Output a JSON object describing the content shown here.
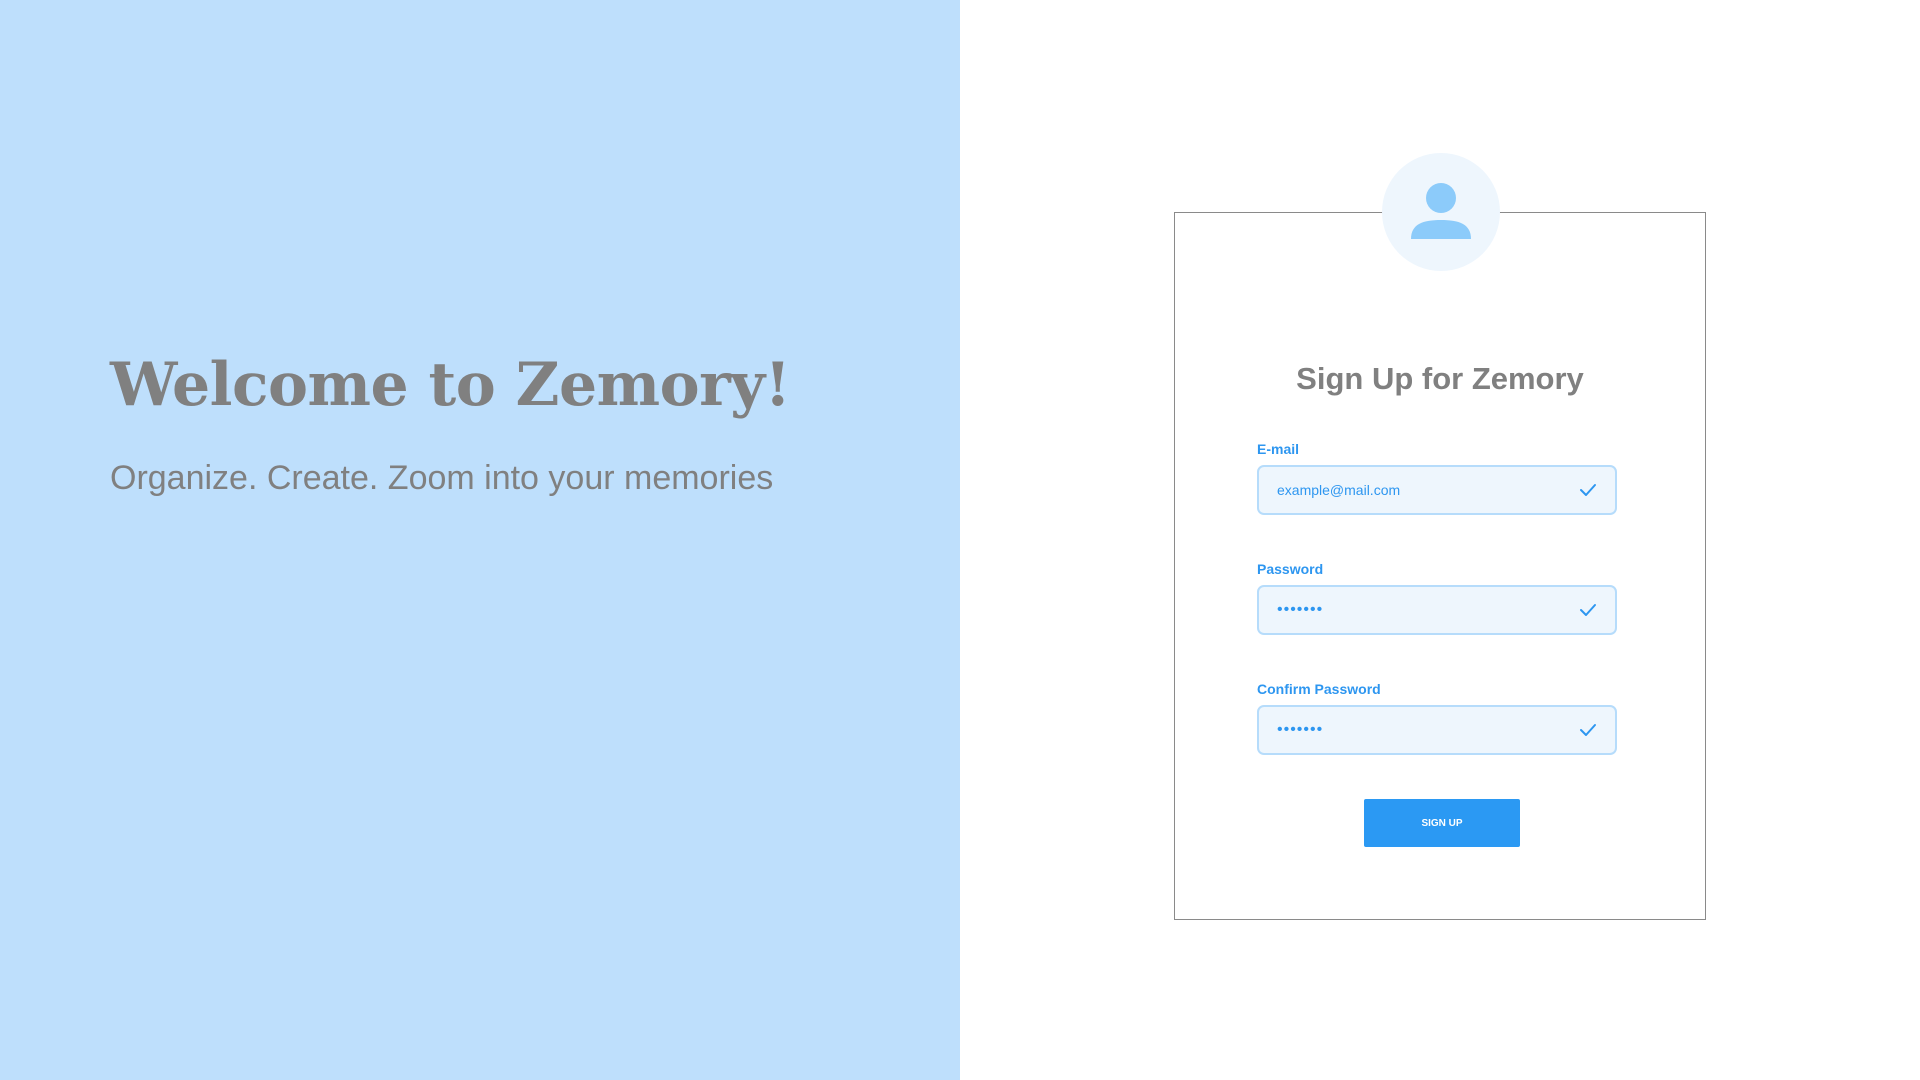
{
  "hero": {
    "title": "Welcome to Zemory!",
    "subtitle": "Organize. Create. Zoom into your memories"
  },
  "signup": {
    "avatar_icon": "user-icon",
    "title": "Sign Up for Zemory",
    "fields": [
      {
        "label": "E-mail",
        "value": "example@mail.com",
        "type": "email",
        "status_icon": "check-icon"
      },
      {
        "label": "Password",
        "value": "•••••••",
        "type": "password",
        "status_icon": "check-icon"
      },
      {
        "label": "Confirm Password",
        "value": "•••••••",
        "type": "password",
        "status_icon": "check-icon"
      }
    ],
    "button_label": "SIGN UP"
  },
  "colors": {
    "left_panel_bg": "#bedffc",
    "accent": "#2b99f3",
    "field_bg": "#eef6fd",
    "field_border": "#b6dcfb",
    "heading_text": "#808080"
  }
}
